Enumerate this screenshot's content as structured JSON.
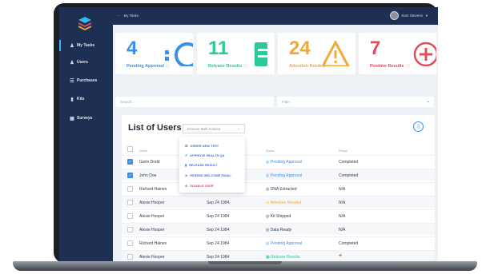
{
  "topbar": {
    "breadcrumb_icon": "ellipsis-icon",
    "breadcrumb": "My Tasks",
    "user_name": "Sam Stevens"
  },
  "sidebar": {
    "items": [
      {
        "label": "My Tasks",
        "icon": "user-tasks-icon"
      },
      {
        "label": "Users",
        "icon": "users-icon"
      },
      {
        "label": "Purchases",
        "icon": "purchases-icon"
      },
      {
        "label": "Kits",
        "icon": "kit-icon"
      },
      {
        "label": "Surveys",
        "icon": "survey-icon"
      }
    ]
  },
  "stats": [
    {
      "value": "4",
      "label": "Pending Approval",
      "color": "#3b8fe8"
    },
    {
      "value": "11",
      "label": "Release Results",
      "color": "#2ec99a"
    },
    {
      "value": "24",
      "label": "Attention Needed",
      "color": "#f0a93c"
    },
    {
      "value": "7",
      "label": "Positive Results",
      "color": "#e8475c"
    }
  ],
  "search": {
    "placeholder": "Search..."
  },
  "filter": {
    "placeholder": "Filter"
  },
  "list": {
    "title": "List of Users",
    "bulk_placeholder": "Choose Bulk Actions",
    "columns": {
      "name": "Name",
      "status": "Status",
      "result": "Result"
    },
    "rows": [
      {
        "name": "Garin Dodd",
        "date": "",
        "status": "Pending Approval",
        "status_type": "pending",
        "result": "Completed",
        "checked": true
      },
      {
        "name": "John Doe",
        "date": "",
        "status": "Pending Approval",
        "status_type": "pending",
        "result": "Completed",
        "checked": true
      },
      {
        "name": "Richard Haines",
        "date": "",
        "status": "DNA Extracted",
        "status_type": "neutral",
        "result": "N/A",
        "checked": false
      },
      {
        "name": "Alexie Hooper",
        "date": "Sep 24 1984",
        "status": "Attention Needed",
        "status_type": "attention",
        "result": "N/A",
        "checked": false
      },
      {
        "name": "Alexie Hooper",
        "date": "Sep 24 1984",
        "status": "Kit Shipped",
        "status_type": "neutral",
        "result": "N/A",
        "checked": false
      },
      {
        "name": "Alexie Hooper",
        "date": "Sep 24 1984",
        "status": "Data Ready",
        "status_type": "neutral",
        "result": "N/A",
        "checked": false
      },
      {
        "name": "Richard Haines",
        "date": "Sep 24 1984",
        "status": "Pending Approval",
        "status_type": "pending",
        "result": "Completed",
        "checked": false
      },
      {
        "name": "Alexie Hooper",
        "date": "Sep 24 1984",
        "status": "Release Results",
        "status_type": "release",
        "result": "+",
        "checked": false
      }
    ]
  },
  "bulk_menu": [
    {
      "label": "ORDER NEW TEST",
      "danger": false
    },
    {
      "label": "APPROVE HEALTH QA",
      "danger": false
    },
    {
      "label": "RELEASE RESULT",
      "danger": false
    },
    {
      "label": "RESEND WELCOME EMAIL",
      "danger": false
    },
    {
      "label": "DISABLE USER",
      "danger": true
    }
  ],
  "colors": {
    "sidebar": "#1d2f52",
    "accent": "#3b8fe8",
    "success": "#2ec99a",
    "warning": "#f0a93c",
    "danger": "#e8475c"
  }
}
